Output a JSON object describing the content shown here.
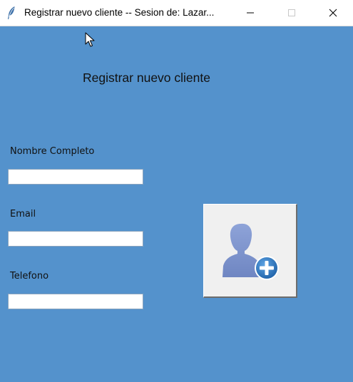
{
  "window": {
    "title": "Registrar nuevo cliente -- Sesion de: Lazar...",
    "app_icon": "feather-icon",
    "controls": [
      "minimize-icon",
      "maximize-icon",
      "close-icon"
    ]
  },
  "form": {
    "heading": "Registrar nuevo cliente",
    "fields": [
      {
        "label": "Nombre Completo",
        "value": ""
      },
      {
        "label": "Email",
        "value": ""
      },
      {
        "label": "Telefono",
        "value": ""
      }
    ],
    "submit_icon": "add-user-icon"
  },
  "colors": {
    "background": "#5492cc",
    "button_face": "#f0f0f0",
    "icon_person": "#7d94cc",
    "icon_plus": "#2f7dc4"
  }
}
